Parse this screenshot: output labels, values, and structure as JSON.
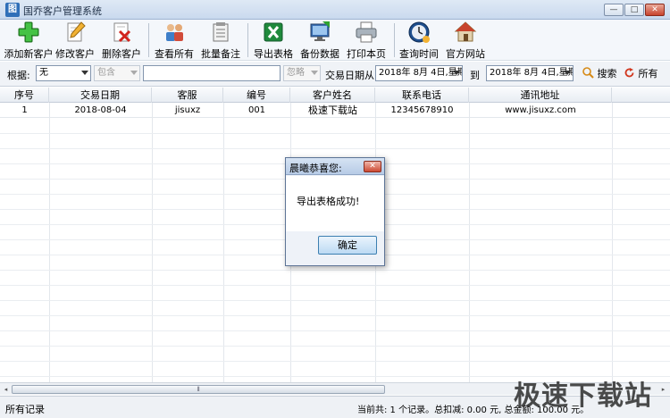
{
  "window": {
    "title": "国乔客户管理系统",
    "app_icon_glyph": "图",
    "minimize": "—",
    "maximize": "□",
    "close": "✕"
  },
  "toolbar": {
    "buttons": [
      {
        "label": "添加新客户",
        "icon": "add-plus-icon"
      },
      {
        "label": "修改客户",
        "icon": "edit-pencil-icon"
      },
      {
        "label": "删除客户",
        "icon": "delete-doc-icon"
      },
      {
        "label": "查看所有",
        "icon": "users-icon"
      },
      {
        "label": "批量备注",
        "icon": "notes-icon"
      },
      {
        "label": "导出表格",
        "icon": "excel-icon"
      },
      {
        "label": "备份数据",
        "icon": "backup-monitor-icon"
      },
      {
        "label": "打印本页",
        "icon": "printer-icon"
      },
      {
        "label": "查询时间",
        "icon": "clock-icon"
      },
      {
        "label": "官方网站",
        "icon": "home-icon"
      }
    ]
  },
  "filter": {
    "basis_label": "根据:",
    "basis_value": "无",
    "match_value": "包含",
    "ignore_value": "忽略",
    "date_from_label": "交易日期从:",
    "date_from_value": "2018年 8月 4日,星期",
    "date_to_label": "到",
    "date_to_value": "2018年 8月 4日,星期",
    "search_label": "搜索",
    "all_label": "所有"
  },
  "table": {
    "columns": [
      "序号",
      "交易日期",
      "客服",
      "编号",
      "客户姓名",
      "联系电话",
      "通讯地址"
    ],
    "rows": [
      [
        "1",
        "2018-08-04",
        "jisuxz",
        "001",
        "极速下载站",
        "12345678910",
        "www.jisuxz.com"
      ]
    ]
  },
  "scrollbar": {
    "grip": "⦀",
    "left_arrow": "◂",
    "right_arrow": "▸"
  },
  "status": {
    "left": "所有记录",
    "right": "当前共: 1 个记录。总扣减: 0.00 元, 总金额: 100.00 元。"
  },
  "dialog": {
    "title": "晨曦恭喜您:",
    "message": "导出表格成功!",
    "ok_label": "确定",
    "close": "✕"
  },
  "watermark": "极速下载站",
  "colors": {
    "title_bar": "#c9d9ee",
    "accent_blue": "#2f6fb8",
    "ok_button": "#bcdaf3",
    "close_red": "#cc4a33"
  }
}
